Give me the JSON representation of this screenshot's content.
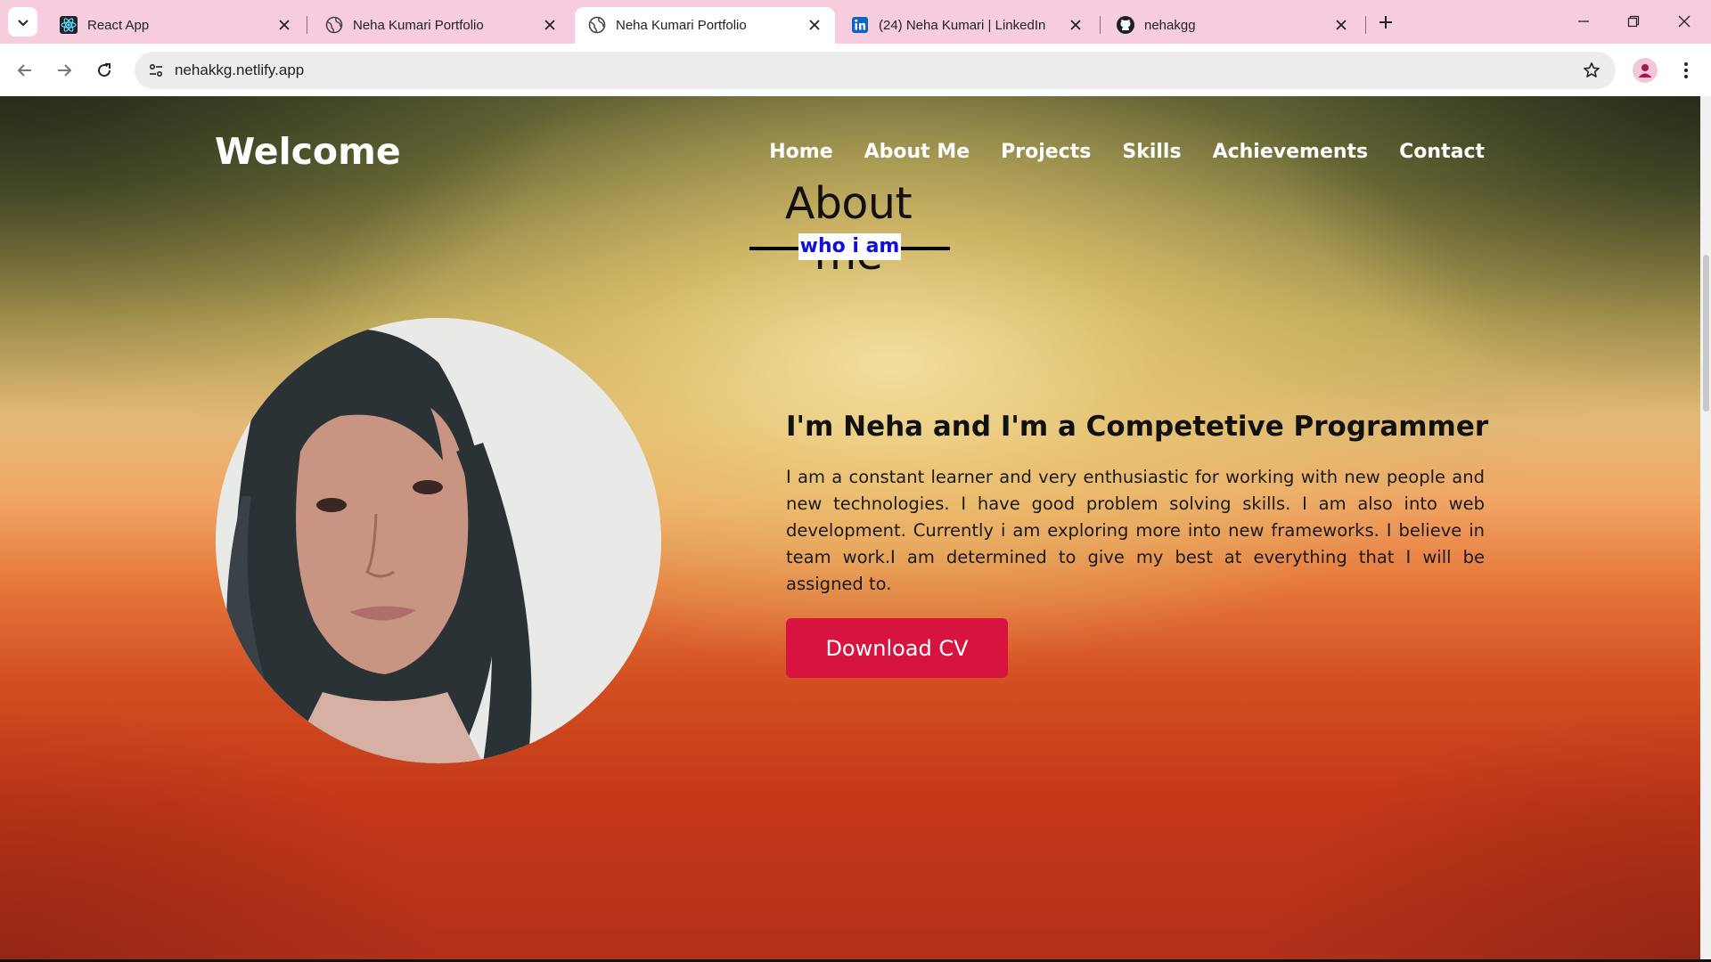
{
  "browser": {
    "tabs": [
      {
        "title": "React App",
        "icon": "react-icon",
        "active": false
      },
      {
        "title": "Neha Kumari Portfolio",
        "icon": "globe-icon",
        "active": false
      },
      {
        "title": "Neha Kumari Portfolio",
        "icon": "globe-icon",
        "active": true
      },
      {
        "title": "(24) Neha Kumari | LinkedIn",
        "icon": "linkedin-icon",
        "active": false
      },
      {
        "title": "nehakgg",
        "icon": "github-icon",
        "active": false
      }
    ],
    "url": "nehakkg.netlify.app",
    "colors": {
      "tabbar": "#f7ccdf",
      "toolbar": "#ffffff",
      "omnibox": "#ededed"
    }
  },
  "site": {
    "brand": "Welcome",
    "nav": [
      "Home",
      "About Me",
      "Projects",
      "Skills",
      "Achievements",
      "Contact"
    ],
    "about": {
      "title": "About me",
      "subtitle": "who i am",
      "heading": "I'm Neha and I'm a Competetive Programmer",
      "paragraph": "I am a constant learner and very enthusiastic for working with new people and new technologies. I have good problem solving skills. I am also into web development. Currently i am exploring more into new frameworks. I believe in team work.I am determined to give my best at everything that I will be assigned to.",
      "cv_button": "Download CV"
    },
    "colors": {
      "accent": "#d71440",
      "subtitle": "#1010d8"
    }
  }
}
